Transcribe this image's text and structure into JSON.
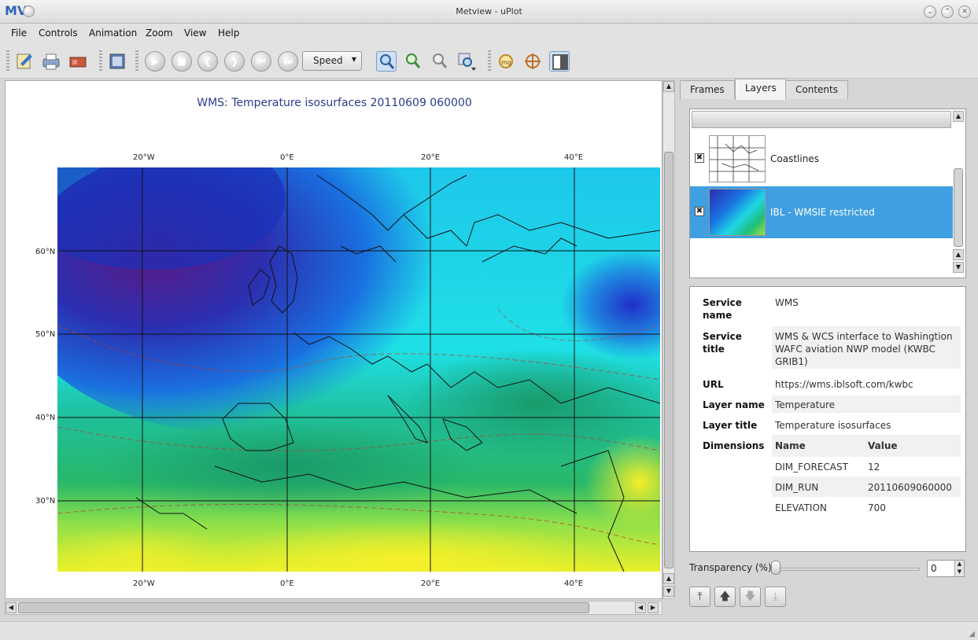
{
  "window": {
    "title": "Metview - uPlot",
    "logo": "MV"
  },
  "menu": [
    "File",
    "Controls",
    "Animation",
    "Zoom",
    "View",
    "Help"
  ],
  "toolbar": {
    "speed_label": "Speed",
    "icons": [
      "edit-icon",
      "print-icon",
      "export-icon",
      "frames-icon",
      "play-icon",
      "stop-icon",
      "prev-icon",
      "next-icon",
      "first-icon",
      "last-icon",
      "zoom-icon",
      "zoom-in-icon",
      "zoom-out-icon",
      "zoom-stack-icon",
      "magnifier-icon",
      "cursor-data-icon",
      "side-panel-icon"
    ]
  },
  "plot": {
    "title": "WMS: Temperature isosurfaces 20110609 060000",
    "lon_labels": [
      "20°W",
      "0°E",
      "20°E",
      "40°E"
    ],
    "lat_labels": [
      "60°N",
      "50°N",
      "40°N",
      "30°N"
    ]
  },
  "tabs": [
    "Frames",
    "Layers",
    "Contents"
  ],
  "active_tab": "Layers",
  "layers": [
    {
      "label": "Coastlines",
      "checked": true,
      "selected": false
    },
    {
      "label": "IBL - WMSIE restricted",
      "checked": true,
      "selected": true
    }
  ],
  "info": {
    "service_name_key": "Service name",
    "service_name": "WMS",
    "service_title_key": "Service title",
    "service_title": "WMS & WCS interface to Washingtion WAFC aviation NWP model (KWBC GRIB1)",
    "url_key": "URL",
    "url": "https://wms.iblsoft.com/kwbc",
    "layer_name_key": "Layer name",
    "layer_name": "Temperature",
    "layer_title_key": "Layer title",
    "layer_title": "Temperature isosurfaces",
    "dimensions_key": "Dimensions",
    "dim_header_name": "Name",
    "dim_header_value": "Value",
    "dimensions": [
      {
        "name": "DIM_FORECAST",
        "value": "12"
      },
      {
        "name": "DIM_RUN",
        "value": "20110609060000"
      },
      {
        "name": "ELEVATION",
        "value": "700"
      }
    ]
  },
  "transparency": {
    "label": "Transparency (%)",
    "value": "0"
  }
}
